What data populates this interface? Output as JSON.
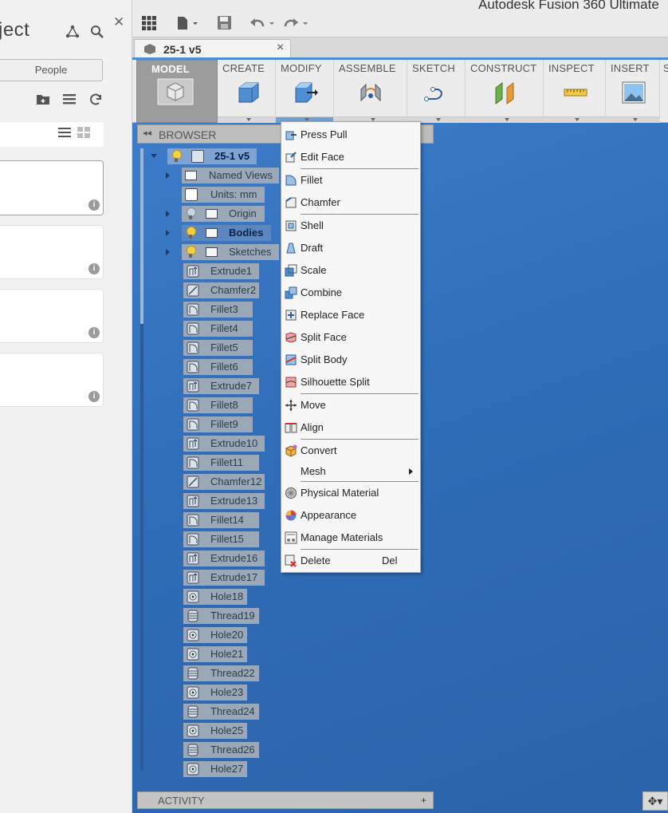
{
  "app": {
    "title": "Autodesk Fusion 360 Ultimate"
  },
  "left_panel": {
    "title": "ject",
    "people_button": "People",
    "info_glyph": "i"
  },
  "document_tab": {
    "label": "25-1 v5",
    "close": "×"
  },
  "toolbar": {
    "grid_icon": "grid-icon",
    "file_icon": "file-icon",
    "save_icon": "save-icon",
    "undo_icon": "undo-icon",
    "redo_icon": "redo-icon"
  },
  "ribbon": {
    "model": "MODEL",
    "create": "CREATE",
    "modify": "MODIFY",
    "assemble": "ASSEMBLE",
    "sketch": "SKETCH",
    "construct": "CONSTRUCT",
    "inspect": "INSPECT",
    "insert": "INSERT",
    "more": "S"
  },
  "browser": {
    "title": "BROWSER",
    "root": "25-1 v5",
    "folders": {
      "named_views": "Named Views",
      "units": "Units: mm",
      "origin": "Origin",
      "bodies": "Bodies",
      "sketches": "Sketches"
    },
    "features": [
      "Extrude1",
      "Chamfer2",
      "Fillet3",
      "Fillet4",
      "Fillet5",
      "Fillet6",
      "Extrude7",
      "Fillet8",
      "Fillet9",
      "Extrude10",
      "Fillet11",
      "Chamfer12",
      "Extrude13",
      "Fillet14",
      "Fillet15",
      "Extrude16",
      "Extrude17",
      "Hole18",
      "Thread19",
      "Hole20",
      "Hole21",
      "Thread22",
      "Hole23",
      "Thread24",
      "Hole25",
      "Thread26",
      "Hole27"
    ]
  },
  "modify_menu": {
    "press_pull": "Press Pull",
    "edit_face": "Edit Face",
    "fillet": "Fillet",
    "chamfer": "Chamfer",
    "shell": "Shell",
    "draft": "Draft",
    "scale": "Scale",
    "combine": "Combine",
    "replace_face": "Replace Face",
    "split_face": "Split Face",
    "split_body": "Split Body",
    "silhouette_split": "Silhouette Split",
    "move": "Move",
    "align": "Align",
    "convert": "Convert",
    "mesh": "Mesh",
    "physical_material": "Physical Material",
    "appearance": "Appearance",
    "manage_materials": "Manage Materials",
    "delete": "Delete",
    "delete_shortcut": "Del"
  },
  "activity": {
    "label": "ACTIVITY",
    "plus": "+"
  },
  "colors": {
    "accent": "#4b8fd1",
    "canvas": "#2f6db8",
    "highlight": "#5c86bf"
  }
}
